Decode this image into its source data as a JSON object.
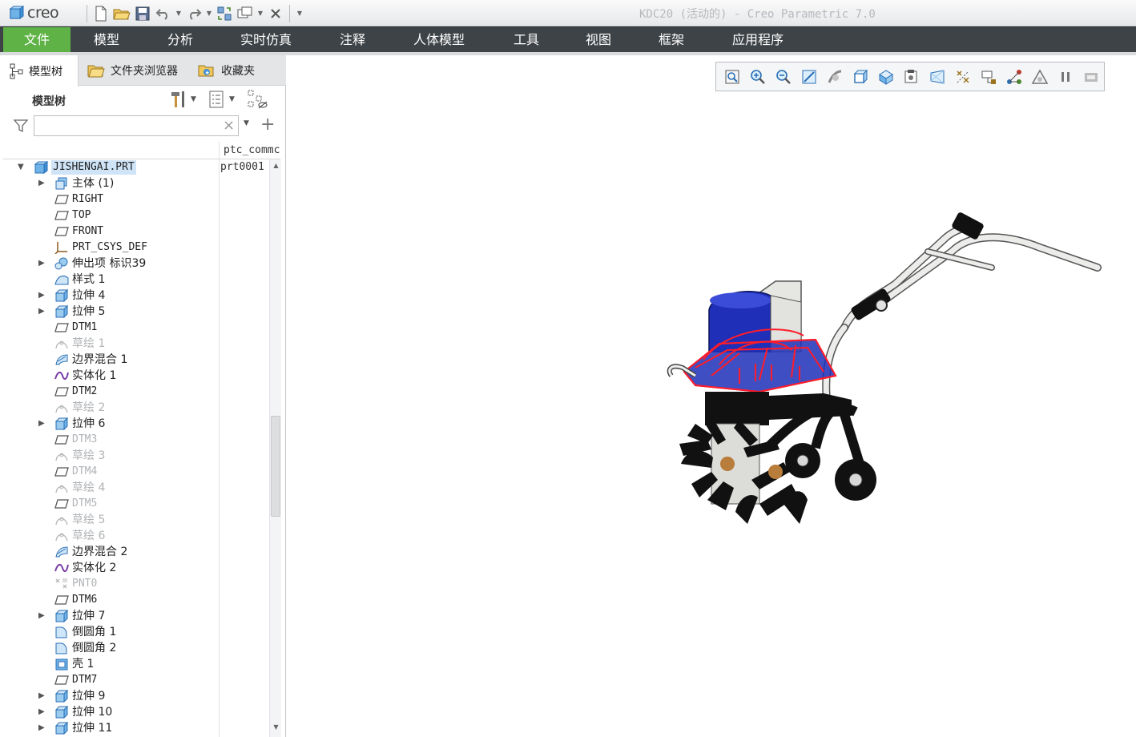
{
  "app": {
    "logo_text": "creo",
    "window_title": "KDC20 (活动的) - Creo Parametric 7.0"
  },
  "menu": {
    "items": [
      "文件",
      "模型",
      "分析",
      "实时仿真",
      "注释",
      "人体模型",
      "工具",
      "视图",
      "框架",
      "应用程序"
    ]
  },
  "panel": {
    "tabs": [
      "模型树",
      "文件夹浏览器",
      "收藏夹"
    ],
    "tree_title": "模型树",
    "search_value": "",
    "column_header": "ptc_commc"
  },
  "tree": [
    {
      "label": "JISHENGAI.PRT",
      "value": "prt0001",
      "expand": "open",
      "icon": "part-icon",
      "level": 0,
      "selected": true,
      "mono": true
    },
    {
      "label": "主体 (1)",
      "expand": "closed",
      "icon": "body-icon",
      "level": 1
    },
    {
      "label": "RIGHT",
      "icon": "datum-plane-icon",
      "level": 1,
      "mono": true
    },
    {
      "label": "TOP",
      "icon": "datum-plane-icon",
      "level": 1,
      "mono": true
    },
    {
      "label": "FRONT",
      "icon": "datum-plane-icon",
      "level": 1,
      "mono": true
    },
    {
      "label": "PRT_CSYS_DEF",
      "icon": "csys-icon",
      "level": 1,
      "mono": true
    },
    {
      "label": "伸出项 标识39",
      "expand": "closed",
      "icon": "protrusion-icon",
      "level": 1
    },
    {
      "label": "样式 1",
      "icon": "style-icon",
      "level": 1
    },
    {
      "label": "拉伸 4",
      "expand": "closed",
      "icon": "extrude-icon",
      "level": 1
    },
    {
      "label": "拉伸 5",
      "expand": "closed",
      "icon": "extrude-icon",
      "level": 1
    },
    {
      "label": "DTM1",
      "icon": "datum-plane-icon",
      "level": 1,
      "mono": true
    },
    {
      "label": "草绘 1",
      "icon": "sketch-icon",
      "level": 1,
      "dim": true
    },
    {
      "label": "边界混合 1",
      "icon": "boundary-blend-icon",
      "level": 1
    },
    {
      "label": "实体化 1",
      "icon": "solidify-icon",
      "level": 1
    },
    {
      "label": "DTM2",
      "icon": "datum-plane-icon",
      "level": 1,
      "mono": true
    },
    {
      "label": "草绘 2",
      "icon": "sketch-icon",
      "level": 1,
      "dim": true
    },
    {
      "label": "拉伸 6",
      "expand": "closed",
      "icon": "extrude-icon",
      "level": 1
    },
    {
      "label": "DTM3",
      "icon": "datum-plane-icon",
      "level": 1,
      "mono": true,
      "dim": true
    },
    {
      "label": "草绘 3",
      "icon": "sketch-icon",
      "level": 1,
      "dim": true
    },
    {
      "label": "DTM4",
      "icon": "datum-plane-icon",
      "level": 1,
      "mono": true,
      "dim": true
    },
    {
      "label": "草绘 4",
      "icon": "sketch-icon",
      "level": 1,
      "dim": true
    },
    {
      "label": "DTM5",
      "icon": "datum-plane-icon",
      "level": 1,
      "mono": true,
      "dim": true
    },
    {
      "label": "草绘 5",
      "icon": "sketch-icon",
      "level": 1,
      "dim": true
    },
    {
      "label": "草绘 6",
      "icon": "sketch-icon",
      "level": 1,
      "dim": true
    },
    {
      "label": "边界混合 2",
      "icon": "boundary-blend-icon",
      "level": 1
    },
    {
      "label": "实体化 2",
      "icon": "solidify-icon",
      "level": 1
    },
    {
      "label": "PNT0",
      "icon": "datum-point-icon",
      "level": 1,
      "mono": true,
      "dim": true
    },
    {
      "label": "DTM6",
      "icon": "datum-plane-icon",
      "level": 1,
      "mono": true
    },
    {
      "label": "拉伸 7",
      "expand": "closed",
      "icon": "extrude-icon",
      "level": 1
    },
    {
      "label": "倒圆角 1",
      "icon": "round-icon",
      "level": 1
    },
    {
      "label": "倒圆角 2",
      "icon": "round-icon",
      "level": 1
    },
    {
      "label": "壳 1",
      "icon": "shell-icon",
      "level": 1
    },
    {
      "label": "DTM7",
      "icon": "datum-plane-icon",
      "level": 1,
      "mono": true
    },
    {
      "label": "拉伸 9",
      "expand": "closed",
      "icon": "extrude-icon",
      "level": 1
    },
    {
      "label": "拉伸 10",
      "expand": "closed",
      "icon": "extrude-icon",
      "level": 1
    },
    {
      "label": "拉伸 11",
      "expand": "closed",
      "icon": "extrude-icon",
      "level": 1
    }
  ],
  "graphics_toolbar": [
    "refit-icon",
    "zoom-in-icon",
    "zoom-out-icon",
    "repaint-icon",
    "reorient-icon",
    "saved-orientations-icon",
    "display-style-icon",
    "view-manager-icon",
    "perspective-icon",
    "datum-display-icon",
    "annotation-display-icon",
    "spin-center-icon",
    "appearance-icon",
    "pause-icon",
    "render-icon"
  ],
  "colors": {
    "menubar": "#3e4347",
    "file_tab": "#5fb346",
    "selection": "#cfe4f7",
    "model_blue": "#1f2fb8",
    "model_red": "#ff1c2a"
  }
}
